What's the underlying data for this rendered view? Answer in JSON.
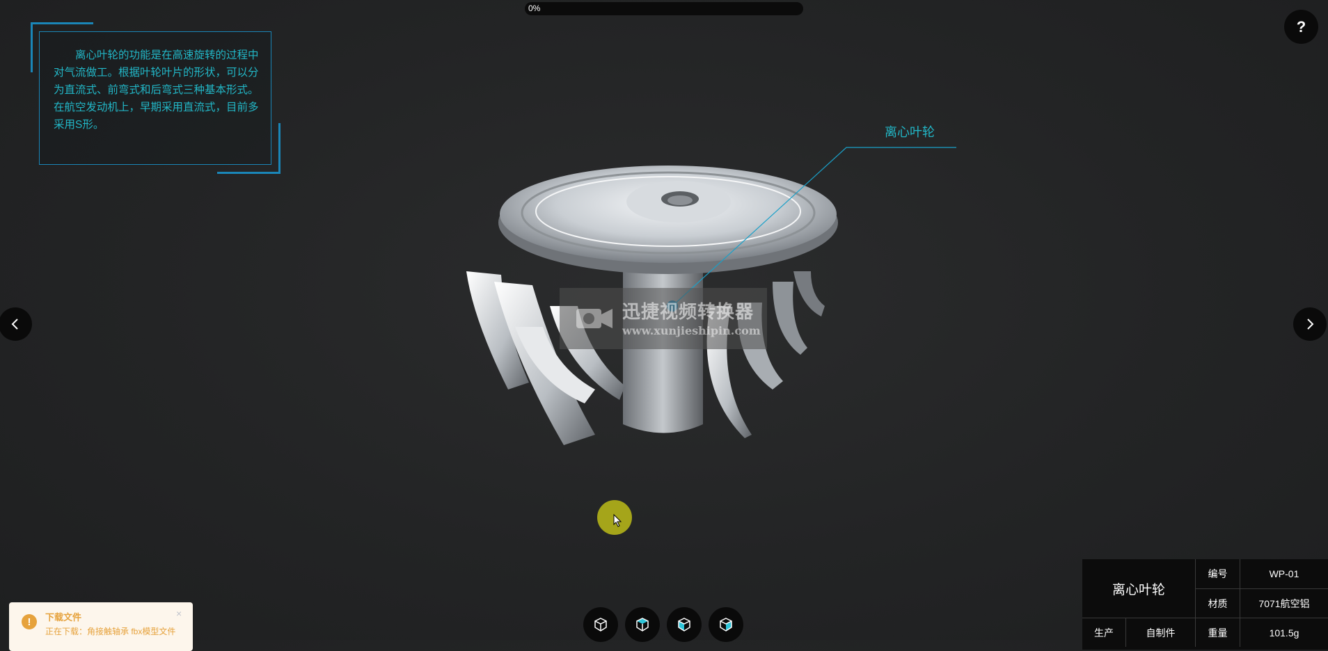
{
  "progress": {
    "label": "0%",
    "value": 0
  },
  "help": {
    "label": "?"
  },
  "info_panel": {
    "text": "离心叶轮的功能是在高速旋转的过程中对气流做工。根据叶轮叶片的形状，可以分为直流式、前弯式和后弯式三种基本形式。在航空发动机上，早期采用直流式，目前多采用S形。"
  },
  "model": {
    "label": "离心叶轮"
  },
  "watermark": {
    "title": "迅捷视频转换器",
    "url": "www.xunjieshipin.com"
  },
  "nav": {
    "prev_icon": "chevron-left-icon",
    "next_icon": "chevron-right-icon"
  },
  "views": [
    {
      "icon": "cube-icon"
    },
    {
      "icon": "cube-top-icon"
    },
    {
      "icon": "cube-front-icon"
    },
    {
      "icon": "cube-side-icon"
    }
  ],
  "spec": {
    "name": "离心叶轮",
    "rows": [
      {
        "key": "编号",
        "value": "WP-01"
      },
      {
        "key": "材质",
        "value": "7071航空铝"
      },
      {
        "key": "重量",
        "value": "101.5g"
      }
    ],
    "production": {
      "key": "生产",
      "value": "自制件"
    }
  },
  "toast": {
    "title": "下载文件",
    "message": "正在下载：角接触轴承 fbx模型文件",
    "close": "×",
    "icon": "!"
  },
  "colors": {
    "accent": "#22b7c7",
    "frame": "#1a86b8",
    "background": "#232425",
    "warning": "#e6a23c"
  }
}
